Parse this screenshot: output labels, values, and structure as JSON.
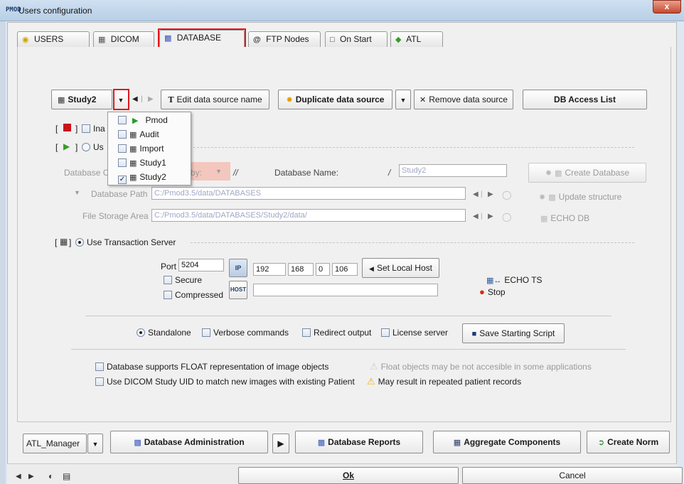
{
  "window": {
    "title": "Users configuration",
    "title_icon": "PMOD",
    "close": "x"
  },
  "tabs": [
    {
      "label": "USERS",
      "icon": "users-icon"
    },
    {
      "label": "DICOM",
      "icon": "dicom-icon"
    },
    {
      "label": "DATABASE",
      "icon": "database-icon",
      "active": true
    },
    {
      "label": "FTP Nodes",
      "icon": "at-icon"
    },
    {
      "label": "On Start",
      "icon": "on-start-icon"
    },
    {
      "label": "ATL",
      "icon": "key-icon"
    }
  ],
  "toolbar": {
    "datasource": "Study2",
    "edit_name": "Edit data source name",
    "duplicate": "Duplicate data source",
    "remove": "Remove data source",
    "access_list": "DB Access List"
  },
  "datasource_menu": [
    "Pmod",
    "Audit",
    "Import",
    "Study1",
    "Study2"
  ],
  "options": {
    "inactive_label": "Ina",
    "use_label": "Us",
    "bracket_open": "[",
    "bracket_close": "]"
  },
  "db": {
    "connection_label": "Database C",
    "by_label": "by:",
    "slash1": "//",
    "name_label": "Database Name:",
    "slash2": "/",
    "name_value": "Study2",
    "path_label": "Database Path",
    "path_value": "C:/Pmod3.5/data/DATABASES",
    "storage_label": "File Storage Area",
    "storage_value": "C:/Pmod3.5/data/DATABASES/Study2/data/",
    "create": "Create Database",
    "update": "Update structure",
    "echo_db": "ECHO DB"
  },
  "transaction": {
    "label": "Use Transaction Server",
    "port_label": "Port",
    "port": "5204",
    "secure": "Secure",
    "compressed": "Compressed",
    "ip": [
      "192",
      "168",
      "0",
      "106"
    ],
    "set_local_host": "Set Local Host",
    "echo_ts": "ECHO TS",
    "stop": "Stop"
  },
  "modes": {
    "standalone": "Standalone",
    "verbose": "Verbose commands",
    "redirect": "Redirect output",
    "license": "License server",
    "save_script": "Save Starting Script"
  },
  "flags": {
    "float": "Database supports FLOAT representation of image objects",
    "float_warn": "Float objects may be not accesible in some applications",
    "dicom_uid": "Use DICOM Study UID to match new images with existing Patient",
    "dicom_warn": "May result in repeated patient records"
  },
  "bottom_tools": {
    "manager": "ATL_Manager",
    "db_admin": "Database Administration",
    "db_reports": "Database Reports",
    "aggregate": "Aggregate Components",
    "create_norm": "Create Norm"
  },
  "footer": {
    "ok": "Ok",
    "cancel": "Cancel"
  }
}
